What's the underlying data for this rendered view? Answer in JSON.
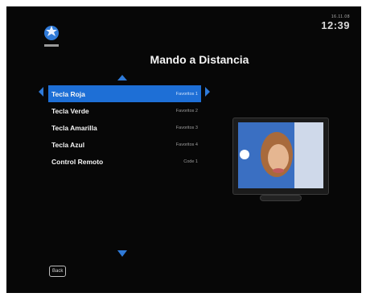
{
  "header": {
    "date": "16.11.08",
    "time": "12:39",
    "title": "Mando a Distancia"
  },
  "menu": {
    "items": [
      {
        "label": "Tecla Roja",
        "value": "Favoritos 1",
        "selected": true
      },
      {
        "label": "Tecla Verde",
        "value": "Favoritos 2",
        "selected": false
      },
      {
        "label": "Tecla Amarilla",
        "value": "Favoritos 3",
        "selected": false
      },
      {
        "label": "Tecla Azul",
        "value": "Favoritos 4",
        "selected": false
      },
      {
        "label": "Control Remoto",
        "value": "Code 1",
        "selected": false
      }
    ]
  },
  "footer": {
    "back_label": "Back"
  },
  "colors": {
    "accent": "#1e6fd6",
    "background": "#070707"
  },
  "icons": {
    "logo": "globe-logo-icon",
    "nav_up": "chevron-up-icon",
    "nav_down": "chevron-down-icon",
    "nav_left": "chevron-left-icon",
    "nav_right": "chevron-right-icon",
    "preview": "tv-preview-icon"
  }
}
